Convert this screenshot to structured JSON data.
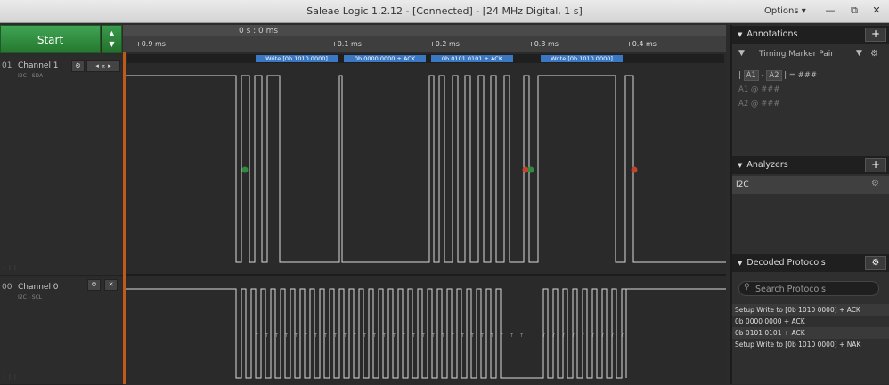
{
  "window": {
    "title": "Saleae Logic 1.2.12 - [Connected] - [24 MHz Digital, 1 s]",
    "options_label": "Options ▾",
    "minimize": "—",
    "restore": "⧉",
    "close": "✕"
  },
  "controls": {
    "start_label": "Start"
  },
  "timeline": {
    "cursor_time": "0 s : 0 ms",
    "ticks": [
      "+0.9 ms",
      "+0.1 ms",
      "+0.2 ms",
      "+0.3 ms",
      "+0.4 ms"
    ]
  },
  "channels": [
    {
      "num": "01",
      "name": "Channel 1",
      "sub": "I2C - SDA"
    },
    {
      "num": "00",
      "name": "Channel 0",
      "sub": "I2C - SCL"
    }
  ],
  "decodes": [
    "Write [0b  1010  0000]",
    "0b  0000  0000 + ACK",
    "0b  0101  0101 + ACK",
    "Write [0b  1010  0000]"
  ],
  "annotations": {
    "header": "Annotations",
    "timing_pair": "Timing Marker Pair",
    "formula_a1": "A1",
    "formula_minus": "-",
    "formula_a2": "A2",
    "formula_result": "|  =  ###",
    "a1_row": "A1  @  ###",
    "a2_row": "A2  @  ###"
  },
  "analyzers": {
    "header": "Analyzers",
    "items": [
      "I2C"
    ]
  },
  "decoded": {
    "header": "Decoded Protocols",
    "search_placeholder": "Search Protocols",
    "rows": [
      "Setup Write to [0b  1010  0000] + ACK",
      "0b  0000  0000 + ACK",
      "0b  0101  0101 + ACK",
      "Setup Write to [0b  1010  0000] + NAK"
    ]
  },
  "colors": {
    "accent_green": "#2e8b3e",
    "decode_blue": "#3b78c4",
    "marker_green": "#2f8c3e",
    "marker_red": "#c0452a"
  }
}
